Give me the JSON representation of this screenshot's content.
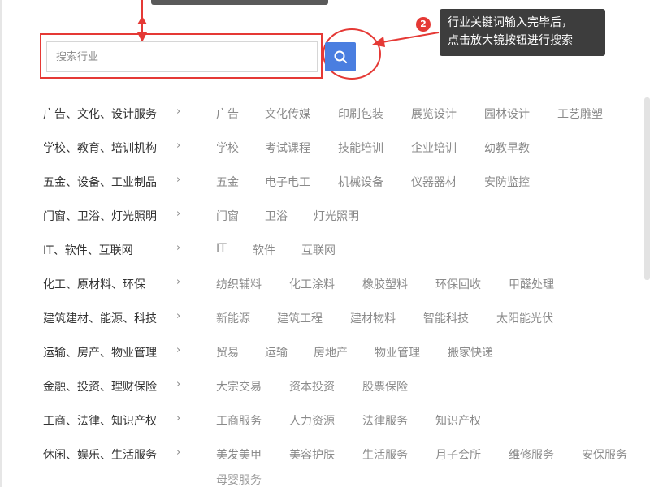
{
  "search": {
    "placeholder": "搜索行业",
    "value": ""
  },
  "tooltip": {
    "step_number": "2",
    "line1": "行业关键词输入完毕后，",
    "line2": "点击放大镜按钮进行搜索"
  },
  "annotation_colors": {
    "highlight": "#e53935",
    "button": "#4a7ee0",
    "tooltip_bg": "#3d3d3d"
  },
  "categories": [
    {
      "name": "广告、文化、设计服务",
      "items": [
        "广告",
        "文化传媒",
        "印刷包装",
        "展览设计",
        "园林设计",
        "工艺雕塑"
      ]
    },
    {
      "name": "学校、教育、培训机构",
      "items": [
        "学校",
        "考试课程",
        "技能培训",
        "企业培训",
        "幼教早教"
      ]
    },
    {
      "name": "五金、设备、工业制品",
      "items": [
        "五金",
        "电子电工",
        "机械设备",
        "仪器器材",
        "安防监控"
      ]
    },
    {
      "name": "门窗、卫浴、灯光照明",
      "items": [
        "门窗",
        "卫浴",
        "灯光照明"
      ]
    },
    {
      "name": "IT、软件、互联网",
      "items": [
        "IT",
        "软件",
        "互联网"
      ]
    },
    {
      "name": "化工、原材料、环保",
      "items": [
        "纺织辅料",
        "化工涂料",
        "橡胶塑料",
        "环保回收",
        "甲醛处理"
      ]
    },
    {
      "name": "建筑建材、能源、科技",
      "items": [
        "新能源",
        "建筑工程",
        "建材物料",
        "智能科技",
        "太阳能光伏"
      ]
    },
    {
      "name": "运输、房产、物业管理",
      "items": [
        "贸易",
        "运输",
        "房地产",
        "物业管理",
        "搬家快递"
      ]
    },
    {
      "name": "金融、投资、理财保险",
      "items": [
        "大宗交易",
        "资本投资",
        "股票保险"
      ]
    },
    {
      "name": "工商、法律、知识产权",
      "items": [
        "工商服务",
        "人力资源",
        "法律服务",
        "知识产权"
      ]
    },
    {
      "name": "休闲、娱乐、生活服务",
      "items": [
        "美发美甲",
        "美容护肤",
        "生活服务",
        "月子会所",
        "维修服务",
        "安保服务"
      ]
    },
    {
      "name": "",
      "items": [
        "母婴服务"
      ]
    }
  ],
  "chevron_glyph": "›"
}
